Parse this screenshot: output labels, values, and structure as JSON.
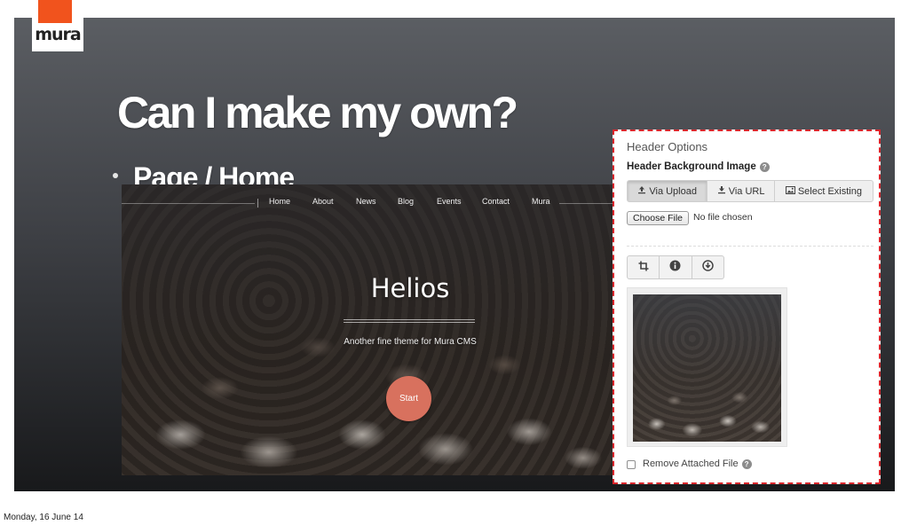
{
  "slide": {
    "logo_text": "mura",
    "title": "Can I make my own?",
    "bullet": "Page / Home"
  },
  "preview": {
    "nav_items": [
      "Home",
      "About",
      "News",
      "Blog",
      "Events",
      "Contact",
      "Mura"
    ],
    "hero_title": "Helios",
    "tagline": "Another fine theme for Mura CMS",
    "start_label": "Start"
  },
  "panel": {
    "title": "Header Options",
    "field_label": "Header Background Image",
    "tabs": [
      {
        "label": "Via Upload",
        "icon": "upload-icon",
        "active": true
      },
      {
        "label": "Via URL",
        "icon": "download-icon",
        "active": false
      },
      {
        "label": "Select Existing",
        "icon": "image-icon",
        "active": false
      }
    ],
    "choose_file_label": "Choose File",
    "no_file_text": "No file chosen",
    "tools": [
      "crop-icon",
      "info-icon",
      "download-circle-icon"
    ],
    "remove_label": "Remove Attached File"
  },
  "footer": {
    "date": "Monday, 16 June 14"
  },
  "colors": {
    "brand": "#f1531d",
    "highlight_border": "#d9262c",
    "start_button": "#d8715e"
  }
}
